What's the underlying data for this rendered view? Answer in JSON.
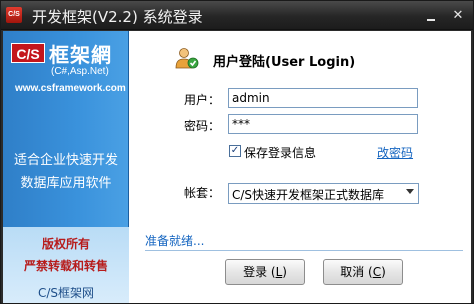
{
  "window": {
    "logo_text": "C/S",
    "title": "开发框架(V2.2) 系统登录",
    "minimize_label": "",
    "close_label": "✕"
  },
  "sidebar": {
    "logo_cs": "C/S",
    "logo_name": "框架網",
    "logo_sub": "(C#,Asp.Net)",
    "logo_url": "www.csframework.com",
    "slogan_line1": "适合企业快速开发",
    "slogan_line2": "数据库应用软件",
    "copyright_line1": "版权所有",
    "copyright_line2": "严禁转载和转售",
    "brand": "C/S框架网"
  },
  "form": {
    "title": "用户登陆(User Login)",
    "user_label": "用户：",
    "user_value": "admin",
    "password_label": "密码：",
    "password_value": "***",
    "remember_checked": true,
    "remember_mark": "✓",
    "remember_label": "保存登录信息",
    "change_password": "改密码",
    "account_label": "帐套：",
    "account_value": "C/S快速开发框架正式数据库",
    "status": "准备就绪..."
  },
  "buttons": {
    "login_text": "登录 (",
    "login_key": "L",
    "login_tail": ")",
    "cancel_text": "取消 (",
    "cancel_key": "C",
    "cancel_tail": ")"
  },
  "colors": {
    "accent_blue": "#3a92dc",
    "link_blue": "#1565c0",
    "copyright_red": "#b71c1c"
  },
  "icons": {
    "login": "user-login-icon",
    "dropdown": "chevron-down-icon"
  }
}
